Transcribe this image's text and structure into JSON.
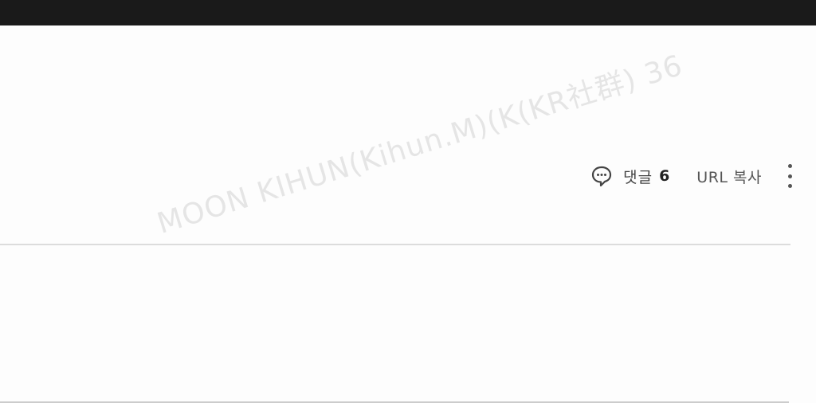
{
  "post_actions": {
    "comment_label": "댓글",
    "comment_count": "6",
    "url_copy_label": "URL 복사"
  },
  "icons": {
    "comment": "speech-bubble-icon",
    "more": "vertical-ellipsis-icon"
  },
  "watermark": {
    "text": "MOON KIHUN(Kihun.M)(K(KR社群) 36"
  },
  "colors": {
    "top_bar": "#1a1a1a",
    "background": "#ffffff",
    "divider": "#dcdcdc",
    "text": "#444444"
  }
}
